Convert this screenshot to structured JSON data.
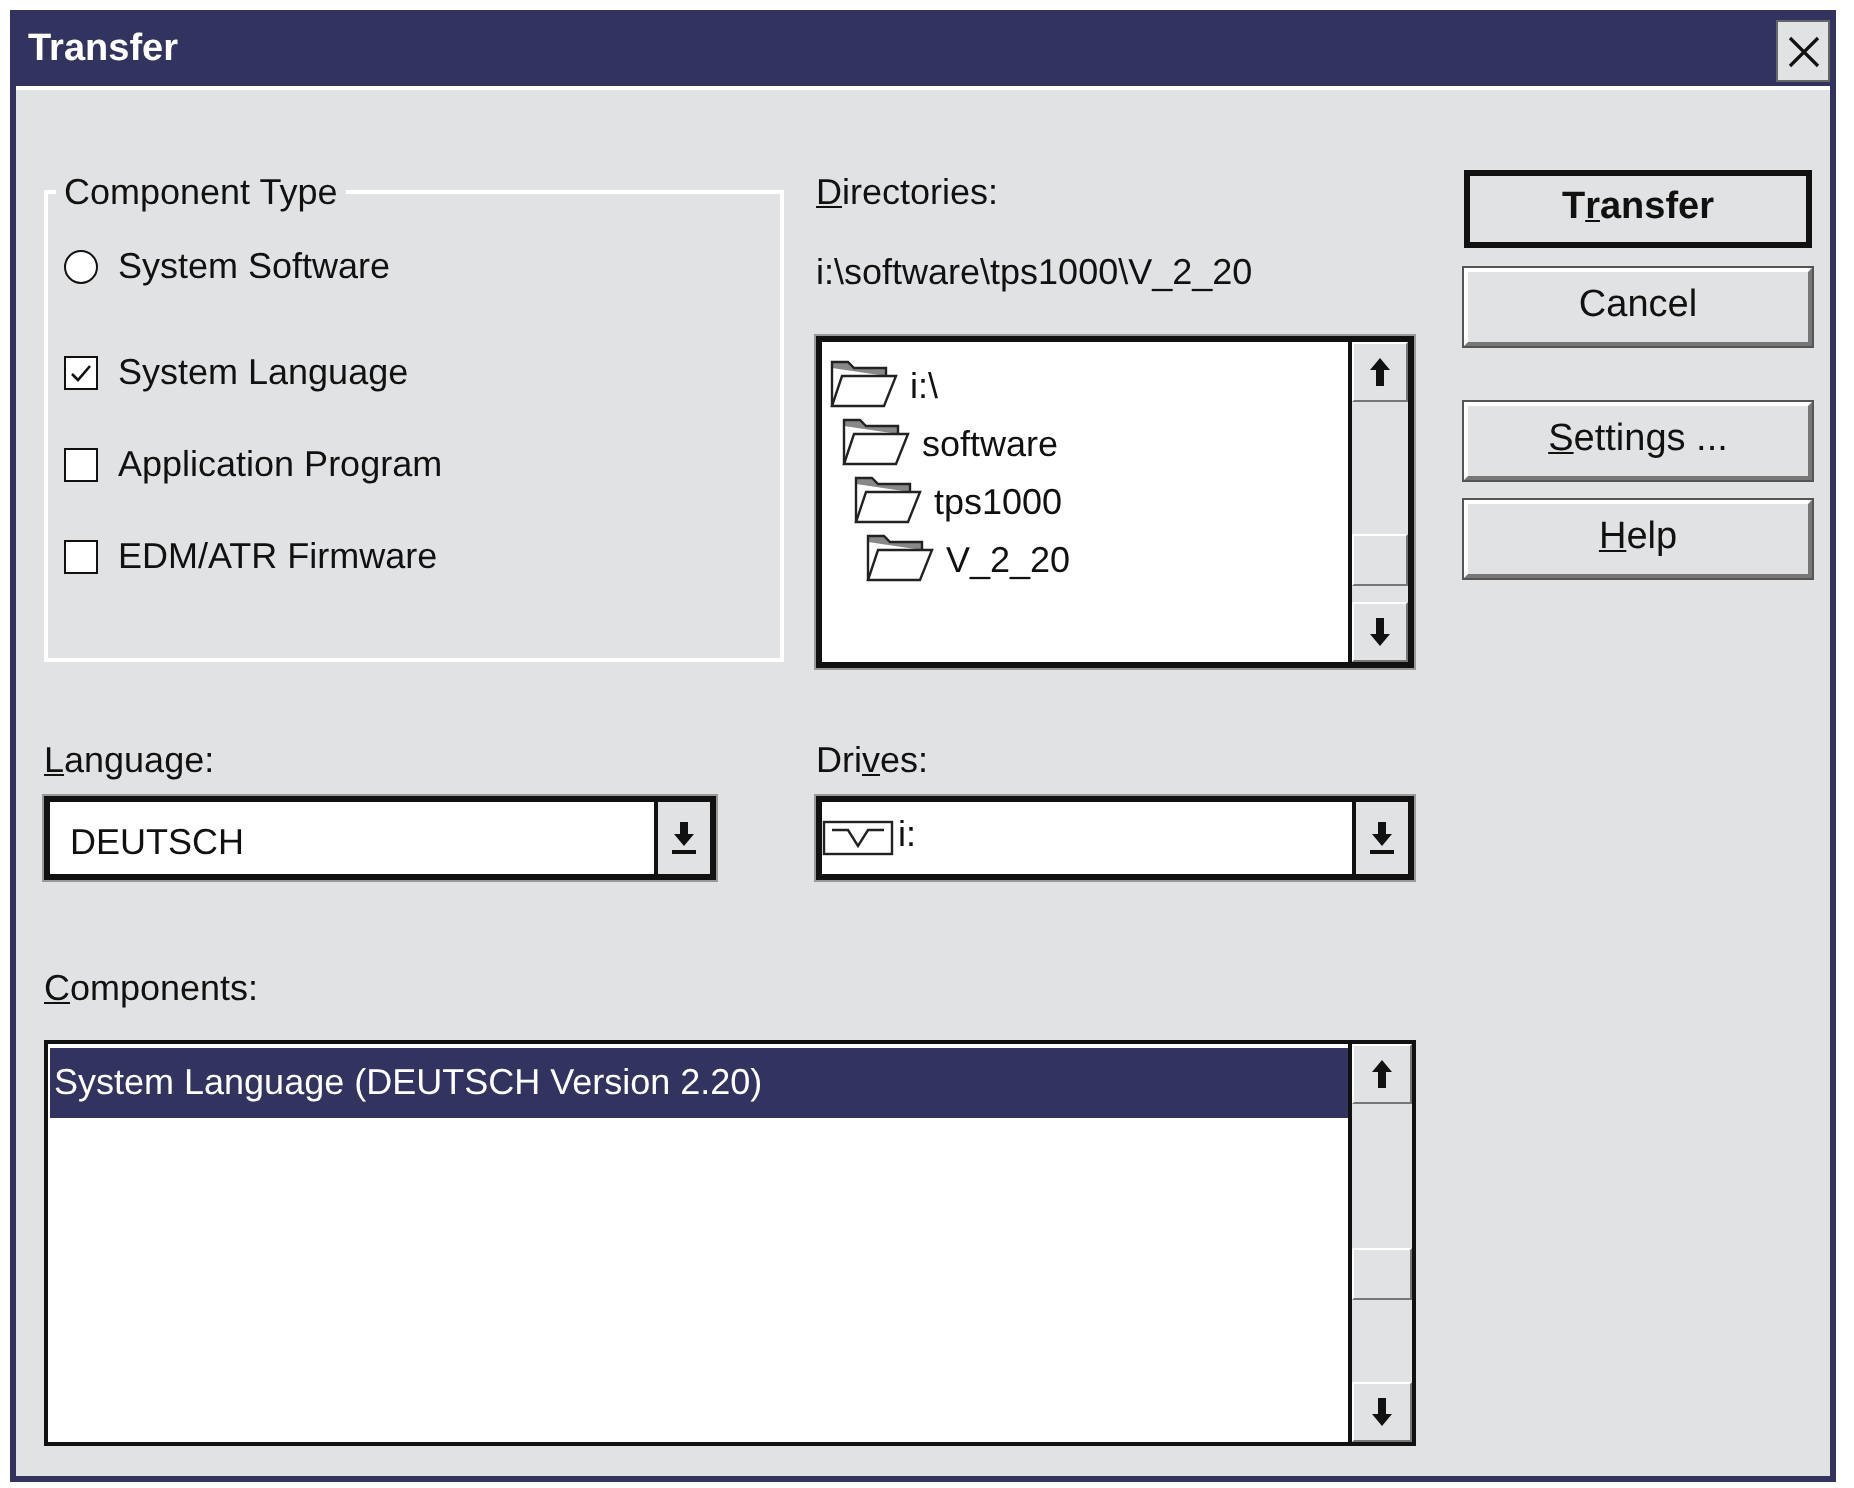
{
  "window": {
    "title": "Transfer"
  },
  "component_type": {
    "title": "Component Type",
    "options": [
      {
        "kind": "radio",
        "label": "System Software",
        "checked": false
      },
      {
        "kind": "checkbox",
        "label": "System Language",
        "checked": true
      },
      {
        "kind": "checkbox",
        "label": "Application Program",
        "checked": false
      },
      {
        "kind": "checkbox",
        "label": "EDM/ATR Firmware",
        "checked": false
      }
    ]
  },
  "directories": {
    "label": [
      {
        "text": "D",
        "underlined": true
      },
      {
        "text": "irectories:",
        "underlined": false
      }
    ],
    "path": "i:\\software\\tps1000\\V_2_20",
    "tree": [
      {
        "label": "i:\\",
        "children": [
          {
            "label": "software",
            "children": [
              {
                "label": "tps1000",
                "children": [
                  {
                    "label": "V_2_20"
                  }
                ]
              }
            ]
          }
        ]
      }
    ]
  },
  "buttons": [
    {
      "label": [
        {
          "text": "T",
          "underlined": false
        },
        {
          "text": "r",
          "underlined": true
        },
        {
          "text": "ansfer",
          "underlined": false
        }
      ],
      "default": true
    },
    {
      "label": [
        {
          "text": "Cancel",
          "underlined": false
        }
      ],
      "default": false
    },
    {
      "label": [
        {
          "text": "S",
          "underlined": true
        },
        {
          "text": "ettings ...",
          "underlined": false
        }
      ],
      "default": false
    },
    {
      "label": [
        {
          "text": "H",
          "underlined": true
        },
        {
          "text": "elp",
          "underlined": false
        }
      ],
      "default": false
    }
  ],
  "language": {
    "label": [
      {
        "text": "L",
        "underlined": true
      },
      {
        "text": "anguage:",
        "underlined": false
      }
    ],
    "value": "DEUTSCH"
  },
  "drives": {
    "label": [
      {
        "text": "Dri",
        "underlined": false
      },
      {
        "text": "v",
        "underlined": true
      },
      {
        "text": "es:",
        "underlined": false
      }
    ],
    "value": "i:"
  },
  "components": {
    "label": [
      {
        "text": "C",
        "underlined": true
      },
      {
        "text": "omponents:",
        "underlined": false
      }
    ],
    "items": [
      {
        "label": "System Language (DEUTSCH Version 2.20)",
        "selected": true
      }
    ]
  }
}
